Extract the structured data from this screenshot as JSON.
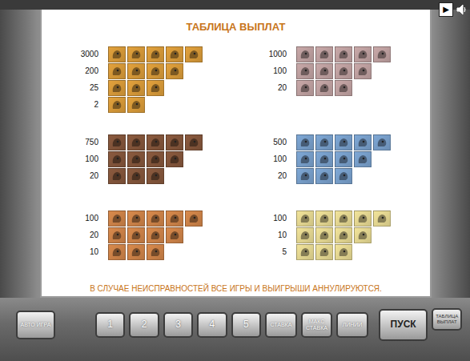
{
  "title": "ТАБЛИЦА ВЫПЛАТ",
  "play": "▶",
  "groups": [
    {
      "color": "#e3a23c",
      "rows": [
        {
          "payout": "3000",
          "symbols": 5
        },
        {
          "payout": "200",
          "symbols": 4
        },
        {
          "payout": "25",
          "symbols": 3
        },
        {
          "payout": "2",
          "symbols": 2
        }
      ]
    },
    {
      "color": "#c9a9a9",
      "rows": [
        {
          "payout": "1000",
          "symbols": 5
        },
        {
          "payout": "100",
          "symbols": 4
        },
        {
          "payout": "20",
          "symbols": 3
        }
      ]
    },
    {
      "color": "#8b5a3e",
      "rows": [
        {
          "payout": "750",
          "symbols": 5
        },
        {
          "payout": "100",
          "symbols": 4
        },
        {
          "payout": "20",
          "symbols": 3
        }
      ]
    },
    {
      "color": "#7fa8d6",
      "rows": [
        {
          "payout": "500",
          "symbols": 5
        },
        {
          "payout": "100",
          "symbols": 4
        },
        {
          "payout": "20",
          "symbols": 3
        }
      ]
    },
    {
      "color": "#d98a4c",
      "rows": [
        {
          "payout": "100",
          "symbols": 5
        },
        {
          "payout": "20",
          "symbols": 4
        },
        {
          "payout": "10",
          "symbols": 3
        }
      ]
    },
    {
      "color": "#f2e49a",
      "rows": [
        {
          "payout": "100",
          "symbols": 5
        },
        {
          "payout": "10",
          "symbols": 4
        },
        {
          "payout": "5",
          "symbols": 3
        }
      ]
    }
  ],
  "footer": "В СЛУЧАЕ НЕИСПРАВНОСТЕЙ ВСЕ ИГРЫ И ВЫИГРЫШИ АННУЛИРУЮТСЯ.",
  "buttons": [
    {
      "label": "АВТО ИГРА",
      "kind": "small"
    },
    {
      "label": "1",
      "kind": "digit"
    },
    {
      "label": "2",
      "kind": "digit"
    },
    {
      "label": "3",
      "kind": "digit"
    },
    {
      "label": "4",
      "kind": "digit"
    },
    {
      "label": "5",
      "kind": "digit"
    },
    {
      "label": "СТАВКА",
      "kind": "func"
    },
    {
      "label": "МАКС СТАВКА",
      "kind": "func"
    },
    {
      "label": "ЛИНИИ",
      "kind": "func"
    },
    {
      "label": "ПУСК",
      "kind": "start"
    },
    {
      "label": "ТАБЛИЦА ВЫПЛАТ",
      "kind": "table"
    }
  ]
}
